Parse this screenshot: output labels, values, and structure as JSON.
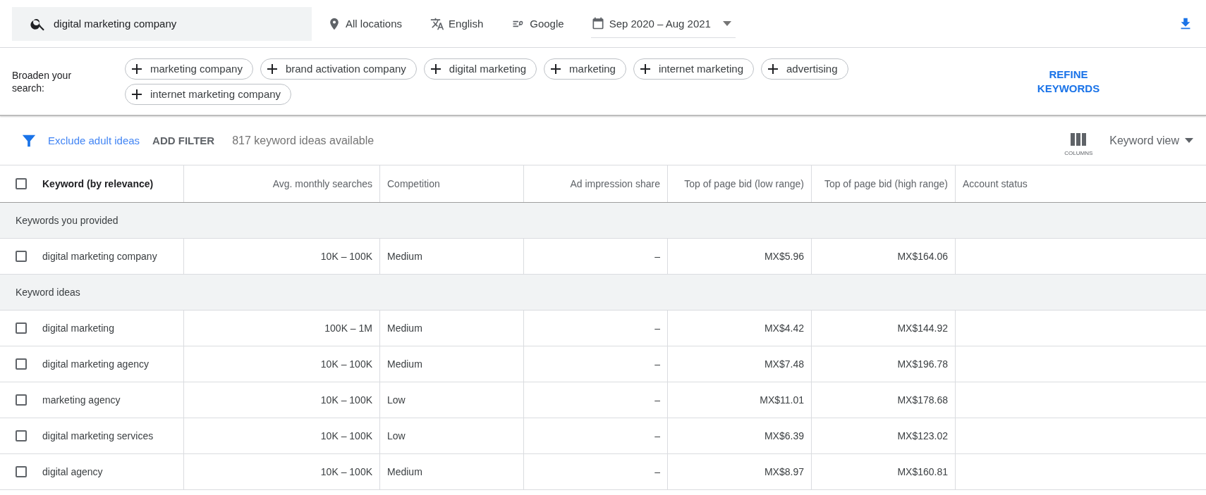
{
  "toolbar": {
    "search": {
      "value": "digital marketing company"
    },
    "location": "All locations",
    "language": "English",
    "network": "Google",
    "date_range": "Sep 2020 – Aug 2021"
  },
  "broaden": {
    "label": "Broaden your search:",
    "chips": [
      "marketing company",
      "brand activation company",
      "digital marketing",
      "marketing",
      "internet marketing",
      "advertising",
      "internet marketing company"
    ],
    "refine": "REFINE KEYWORDS"
  },
  "filter_bar": {
    "exclude": "Exclude adult ideas",
    "add_filter": "ADD FILTER",
    "count": "817 keyword ideas available",
    "columns": "COLUMNS",
    "view": "Keyword view"
  },
  "table": {
    "select_all": {
      "checked": false
    },
    "columns": [
      "Keyword (by relevance)",
      "Avg. monthly searches",
      "Competition",
      "Ad impression share",
      "Top of page bid (low range)",
      "Top of page bid (high range)",
      "Account status"
    ],
    "groups": [
      {
        "title": "Keywords you provided",
        "rows": [
          {
            "checked": false,
            "cells": [
              "digital marketing company",
              "10K – 100K",
              "Medium",
              "–",
              "MX$5.96",
              "MX$164.06"
            ]
          }
        ]
      },
      {
        "title": "Keyword ideas",
        "rows": [
          {
            "checked": false,
            "cells": [
              "digital marketing",
              "100K – 1M",
              "Medium",
              "–",
              "MX$4.42",
              "MX$144.92"
            ]
          },
          {
            "checked": false,
            "cells": [
              "digital marketing agency",
              "10K – 100K",
              "Medium",
              "–",
              "MX$7.48",
              "MX$196.78"
            ]
          },
          {
            "checked": false,
            "cells": [
              "marketing agency",
              "10K – 100K",
              "Low",
              "–",
              "MX$11.01",
              "MX$178.68"
            ]
          },
          {
            "checked": false,
            "cells": [
              "digital marketing services",
              "10K – 100K",
              "Low",
              "–",
              "MX$6.39",
              "MX$123.02"
            ]
          },
          {
            "checked": false,
            "cells": [
              "digital agency",
              "10K – 100K",
              "Medium",
              "–",
              "MX$8.97",
              "MX$160.81"
            ]
          }
        ]
      }
    ]
  }
}
